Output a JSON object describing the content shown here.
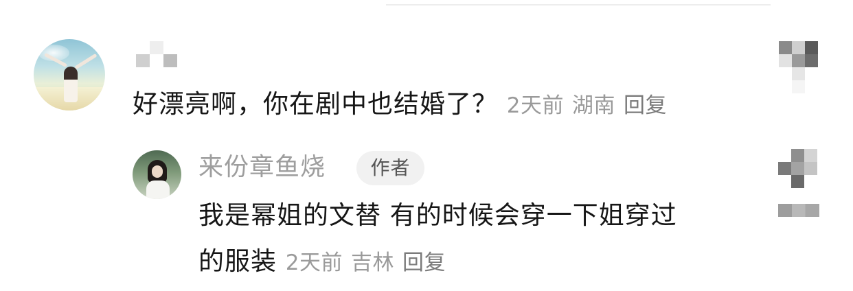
{
  "comment": {
    "text": "好漂亮啊，你在剧中也结婚了？",
    "time": "2天前",
    "location": "湖南",
    "reply_label": "回复",
    "avatar_icon": "user-avatar",
    "username_icon": "blurred-username"
  },
  "reply": {
    "author_name": "来份章鱼烧",
    "author_badge": "作者",
    "text_line1": "我是幂姐的文替 有的时候会穿一下姐穿过",
    "text_line2": "的服装",
    "time": "2天前",
    "location": "吉林",
    "reply_label": "回复",
    "avatar_icon": "author-avatar"
  },
  "actions": {
    "comment_like_icon": "blurred-like-icon",
    "reply_like_icon": "blurred-like-icon",
    "reply_like_count_icon": "blurred-like-count"
  },
  "colors": {
    "text_primary": "#161616",
    "text_meta": "#9a9a9a",
    "badge_bg": "#f1f1f1"
  }
}
